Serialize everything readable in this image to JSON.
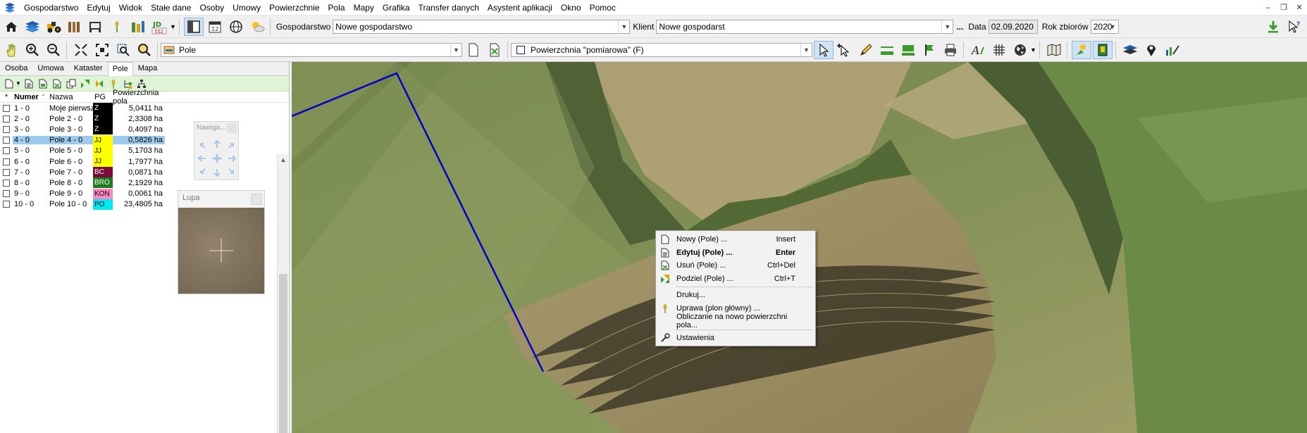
{
  "menubar": {
    "items": [
      "Gospodarstwo",
      "Edytuj",
      "Widok",
      "Stałe dane",
      "Osoby",
      "Umowy",
      "Powierzchnie",
      "Pola",
      "Mapy",
      "Grafika",
      "Transfer danych",
      "Asystent aplikacji",
      "Okno",
      "Pomoc"
    ]
  },
  "toolbar1": {
    "gospodarstwo_label": "Gospodarstwo",
    "gospodarstwo_value": "Nowe gospodarstwo",
    "klient_label": "Klient",
    "klient_value": "Nowe gospodarst",
    "more": "...",
    "data_label": "Data",
    "data_value": "02.09.2020",
    "rok_label": "Rok zbiorów",
    "rok_value": "2020",
    "calendar_day": "12",
    "icon_badge": "552"
  },
  "toolbar2": {
    "layer_value": "Pole",
    "surface_value": "Powierzchnia \"pomiarowa\" (F)"
  },
  "tabs": [
    "Osoba",
    "Umowa",
    "Kataster",
    "Pole",
    "Mapa"
  ],
  "grid": {
    "columns": {
      "star": "*",
      "numer": "Numer",
      "nazwa": "Nazwa",
      "pg": "PG",
      "area": "Powierzchnia pola"
    },
    "rows": [
      {
        "num": "1 - 0",
        "name": "Moje pierwsze p",
        "pg": "Z",
        "pg_bg": "#000000",
        "pg_fg": "#ffffff",
        "area": "5,0411 ha"
      },
      {
        "num": "2 - 0",
        "name": "Pole 2 - 0",
        "pg": "Z",
        "pg_bg": "#000000",
        "pg_fg": "#ffffff",
        "area": "2,3308 ha"
      },
      {
        "num": "3 - 0",
        "name": "Pole 3 - 0",
        "pg": "Z",
        "pg_bg": "#000000",
        "pg_fg": "#ffffff",
        "area": "0,4097 ha"
      },
      {
        "num": "4 - 0",
        "name": "Pole 4 - 0",
        "pg": "JJ",
        "pg_bg": "#ffff00",
        "pg_fg": "#000000",
        "area": "0,5826 ha"
      },
      {
        "num": "5 - 0",
        "name": "Pole 5 - 0",
        "pg": "JJ",
        "pg_bg": "#ffff00",
        "pg_fg": "#000000",
        "area": "5,1703 ha"
      },
      {
        "num": "6 - 0",
        "name": "Pole 6 - 0",
        "pg": "JJ",
        "pg_bg": "#ffff00",
        "pg_fg": "#000000",
        "area": "1,7977 ha"
      },
      {
        "num": "7 - 0",
        "name": "Pole 7 - 0",
        "pg": "BC",
        "pg_bg": "#7a0c3c",
        "pg_fg": "#ffffff",
        "area": "0,0871 ha"
      },
      {
        "num": "8 - 0",
        "name": "Pole 8 - 0",
        "pg": "BRO",
        "pg_bg": "#1d7a1d",
        "pg_fg": "#ffffff",
        "area": "2,1929 ha"
      },
      {
        "num": "9 - 0",
        "name": "Pole 9 - 0",
        "pg": "KON",
        "pg_bg": "#ff88c4",
        "pg_fg": "#000000",
        "area": "0,0061 ha"
      },
      {
        "num": "10 - 0",
        "name": "Pole 10 - 0",
        "pg": "PO",
        "pg_bg": "#00e8f0",
        "pg_fg": "#000000",
        "area": "23,4805 ha"
      }
    ]
  },
  "nav_panel": {
    "title": "Nawiga..."
  },
  "lupa": {
    "title": "Lupa"
  },
  "context_menu": {
    "items": [
      {
        "label": "Nowy (Pole) ...",
        "shortcut": "Insert",
        "icon": "new-document-icon"
      },
      {
        "label": "Edytuj (Pole) ...",
        "shortcut": "Enter",
        "icon": "edit-document-icon",
        "bold": true
      },
      {
        "label": "Usuń (Pole) ...",
        "shortcut": "Ctrl+Del",
        "icon": "delete-document-icon"
      },
      {
        "label": "Podziel (Pole) ...",
        "shortcut": "Ctrl+T",
        "icon": "split-icon"
      },
      {
        "label": "Drukuj...",
        "shortcut": "",
        "icon": ""
      },
      {
        "label": "Uprawa (plon główny) ...",
        "shortcut": "",
        "icon": "crop-icon"
      },
      {
        "label": "Obliczanie na nowo powierzchni pola...",
        "shortcut": "",
        "icon": ""
      },
      {
        "label": "Ustawienia",
        "shortcut": "",
        "icon": "settings-icon"
      }
    ]
  },
  "colors": {
    "boundary": "#0000c8",
    "selection": "#9ccbef",
    "subtoolbar": "#dff3d6"
  }
}
